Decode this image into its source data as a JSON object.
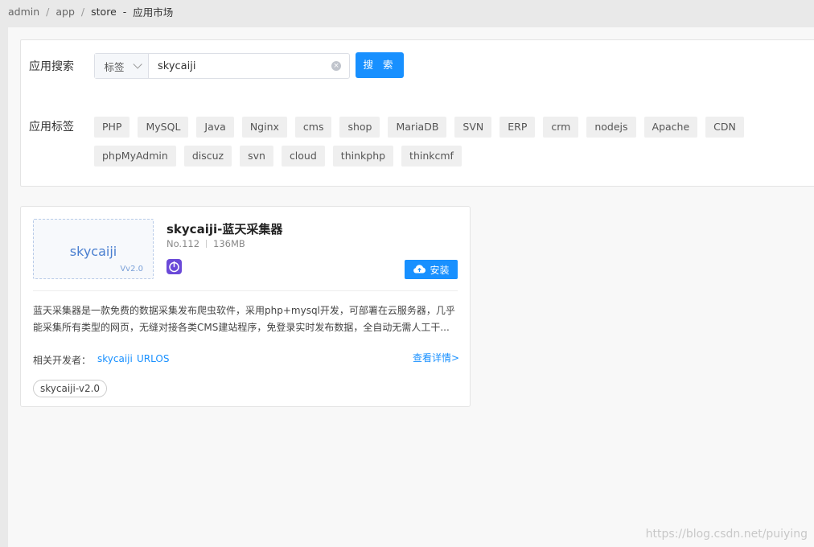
{
  "breadcrumb": {
    "items": [
      "admin",
      "app",
      "store"
    ],
    "sep": "/",
    "dash": "-",
    "current": "应用市场"
  },
  "search": {
    "label": "应用搜索",
    "select_value": "标签",
    "input_value": "skycaiji",
    "button_label": "搜 索"
  },
  "tags": {
    "label": "应用标签",
    "items": [
      "PHP",
      "MySQL",
      "Java",
      "Nginx",
      "cms",
      "shop",
      "MariaDB",
      "SVN",
      "ERP",
      "crm",
      "nodejs",
      "Apache",
      "CDN",
      "phpMyAdmin",
      "discuz",
      "svn",
      "cloud",
      "thinkphp",
      "thinkcmf"
    ]
  },
  "app": {
    "thumb_name": "skycaiji",
    "thumb_version": "Vv2.0",
    "title": "skycaiji-蓝天采集器",
    "number": "No.112",
    "size": "136MB",
    "install_label": "安装",
    "description": "蓝天采集器是一款免费的数据采集发布爬虫软件，采用php+mysql开发，可部署在云服务器，几乎能采集所有类型的网页，无缝对接各类CMS建站程序，免登录实时发布数据，全自动无需人工干...",
    "developers_label": "相关开发者：",
    "developers": [
      "skycaiji",
      "URLOS"
    ],
    "detail_link": "查看详情>",
    "version_tag": "skycaiji-v2.0"
  },
  "watermark": "https://blog.csdn.net/puiying",
  "colors": {
    "accent": "#1890ff",
    "icon_purple": "#6a49d8"
  }
}
